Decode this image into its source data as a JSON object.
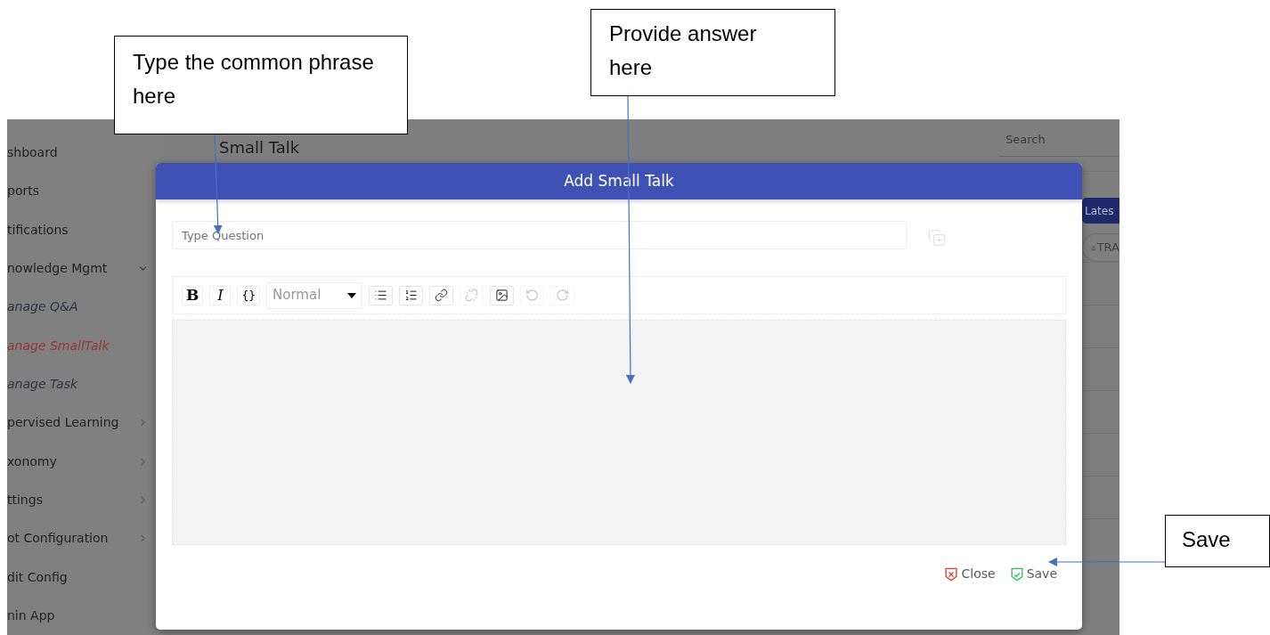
{
  "callouts": [
    {
      "text": "Type the common phrase here"
    },
    {
      "text": "Provide answer here"
    },
    {
      "text": "Save"
    }
  ],
  "sidebar": {
    "items": [
      {
        "label": "shboard",
        "kind": "link",
        "selected": false
      },
      {
        "label": "ports",
        "kind": "link",
        "selected": false
      },
      {
        "label": "tifications",
        "kind": "link",
        "selected": false
      },
      {
        "label": "nowledge Mgmt",
        "kind": "group",
        "expanded": true,
        "selected": false
      },
      {
        "label": "anage Q&A",
        "kind": "sub",
        "selected": false
      },
      {
        "label": "anage SmallTalk",
        "kind": "sub",
        "selected": true
      },
      {
        "label": "anage Task",
        "kind": "sub",
        "selected": false
      },
      {
        "label": "pervised Learning",
        "kind": "group",
        "expanded": false,
        "selected": false
      },
      {
        "label": "xonomy",
        "kind": "group",
        "expanded": false,
        "selected": false
      },
      {
        "label": "ttings",
        "kind": "group",
        "expanded": false,
        "selected": false
      },
      {
        "label": "ot Configuration",
        "kind": "group",
        "expanded": false,
        "selected": false
      },
      {
        "label": "dit Config",
        "kind": "link",
        "selected": false
      },
      {
        "label": "nin App",
        "kind": "link",
        "selected": false
      }
    ]
  },
  "page": {
    "title": "Small Talk",
    "search": {
      "placeholder": "Search"
    },
    "latest_button": "Lates",
    "upload_button": "TRA"
  },
  "dialog": {
    "title": "Add Small Talk",
    "question": {
      "placeholder": "Type Question"
    },
    "toolbar": {
      "format": "Normal",
      "buttons": [
        {
          "kind": "bold",
          "label": "B"
        },
        {
          "kind": "italic",
          "label": "I"
        },
        {
          "kind": "code",
          "label": "{}"
        }
      ],
      "icons": [
        {
          "kind": "bullets",
          "disabled": false
        },
        {
          "kind": "numbers",
          "disabled": false
        },
        {
          "kind": "link",
          "disabled": false
        },
        {
          "kind": "unlink",
          "disabled": true
        },
        {
          "kind": "image",
          "disabled": false
        },
        {
          "kind": "undo",
          "disabled": true
        },
        {
          "kind": "redo",
          "disabled": true
        }
      ]
    },
    "actions": [
      {
        "kind": "close",
        "label": "Close"
      },
      {
        "kind": "save",
        "label": "Save"
      }
    ]
  }
}
